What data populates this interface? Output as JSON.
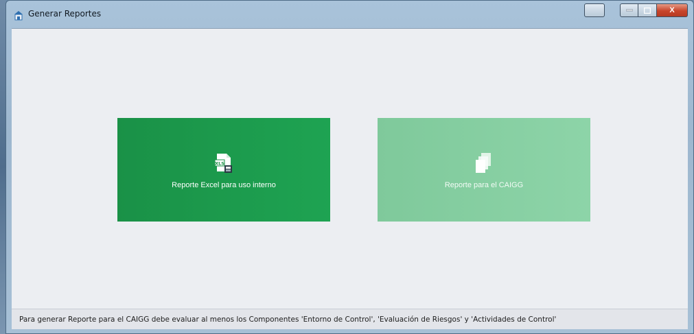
{
  "window": {
    "title": "Generar Reportes",
    "close_glyph": "X"
  },
  "icons": {
    "app": "report-app-icon",
    "excel": "excel-report-icon",
    "caigg": "documents-stack-icon"
  },
  "tiles": {
    "excel_label": "Reporte Excel para uso interno",
    "caigg_label": "Reporte para el CAIGG"
  },
  "status": {
    "message": "Para generar Reporte para el CAIGG debe evaluar al menos los Componentes 'Entorno de Control', 'Evaluación de Riesgos' y 'Actividades de Control'"
  },
  "colors": {
    "excel_tile": "#1ea352",
    "caigg_tile": "#8dd4a8",
    "client_bg": "#eceef2"
  }
}
